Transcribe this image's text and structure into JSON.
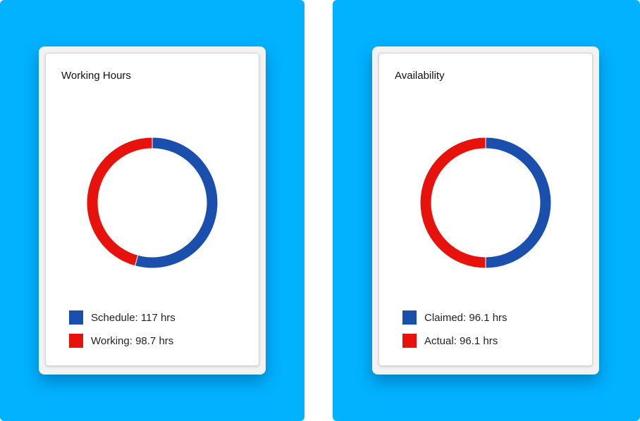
{
  "colors": {
    "blue": "#1b4fae",
    "red": "#e8120c",
    "panel_bg": "#00b2ff"
  },
  "chart_data": [
    {
      "type": "pie",
      "variant": "donut",
      "title": "Working Hours",
      "categories": [
        "Schedule",
        "Working"
      ],
      "values": [
        117,
        98.7
      ],
      "unit": "hrs",
      "colors": [
        "#1b4fae",
        "#e8120c"
      ],
      "legend": [
        "Schedule: 117 hrs",
        "Working: 98.7 hrs"
      ],
      "legend_placement": "bottom"
    },
    {
      "type": "pie",
      "variant": "donut",
      "title": "Availability",
      "categories": [
        "Claimed",
        "Actual"
      ],
      "values": [
        96.1,
        96.1
      ],
      "unit": "hrs",
      "colors": [
        "#1b4fae",
        "#e8120c"
      ],
      "legend": [
        "Claimed: 96.1 hrs",
        "Actual: 96.1 hrs"
      ],
      "legend_placement": "bottom"
    }
  ]
}
